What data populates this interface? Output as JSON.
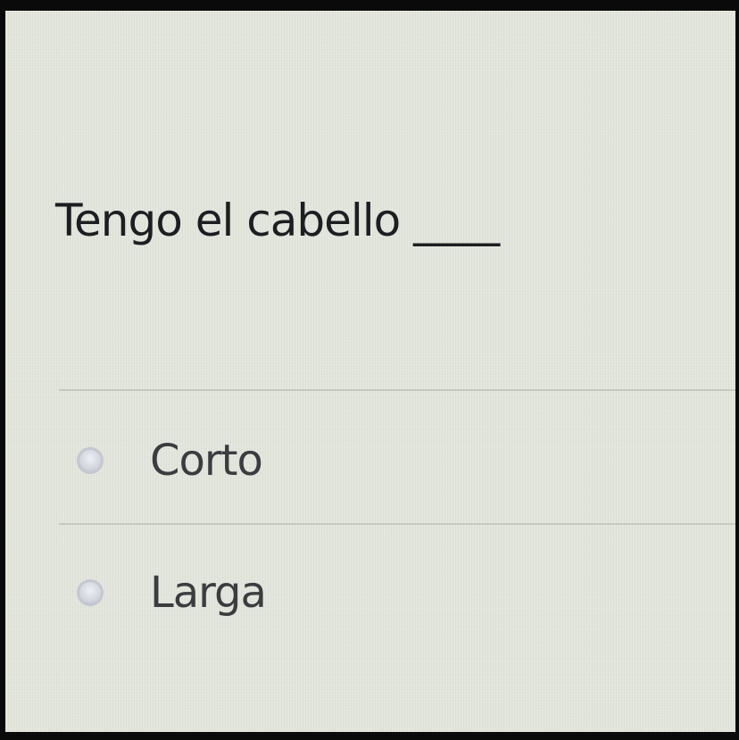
{
  "question": {
    "text": "Tengo el cabello ____"
  },
  "options": [
    {
      "label": "Corto",
      "selected": false
    },
    {
      "label": "Larga",
      "selected": false
    }
  ],
  "colors": {
    "background": "#e3e6dc",
    "text": "#1c1e22",
    "radio": "#c4c7cf",
    "divider": "#c6c9c0"
  }
}
